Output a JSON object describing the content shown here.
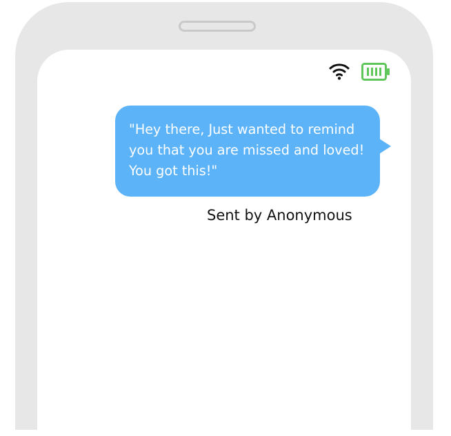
{
  "status_bar": {
    "wifi_icon": "wifi-icon",
    "battery_icon": "battery-icon",
    "battery_color": "#5ec65b"
  },
  "message": {
    "text": "\"Hey there, Just wanted to remind you that you are missed and loved! You got this!\"",
    "bubble_color": "#5cb3f8",
    "text_color": "#ffffff"
  },
  "sender": {
    "label": "Sent by Anonymous"
  },
  "colors": {
    "frame": "#e7e7e7",
    "speaker": "#c9c9c9",
    "screen": "#ffffff"
  }
}
